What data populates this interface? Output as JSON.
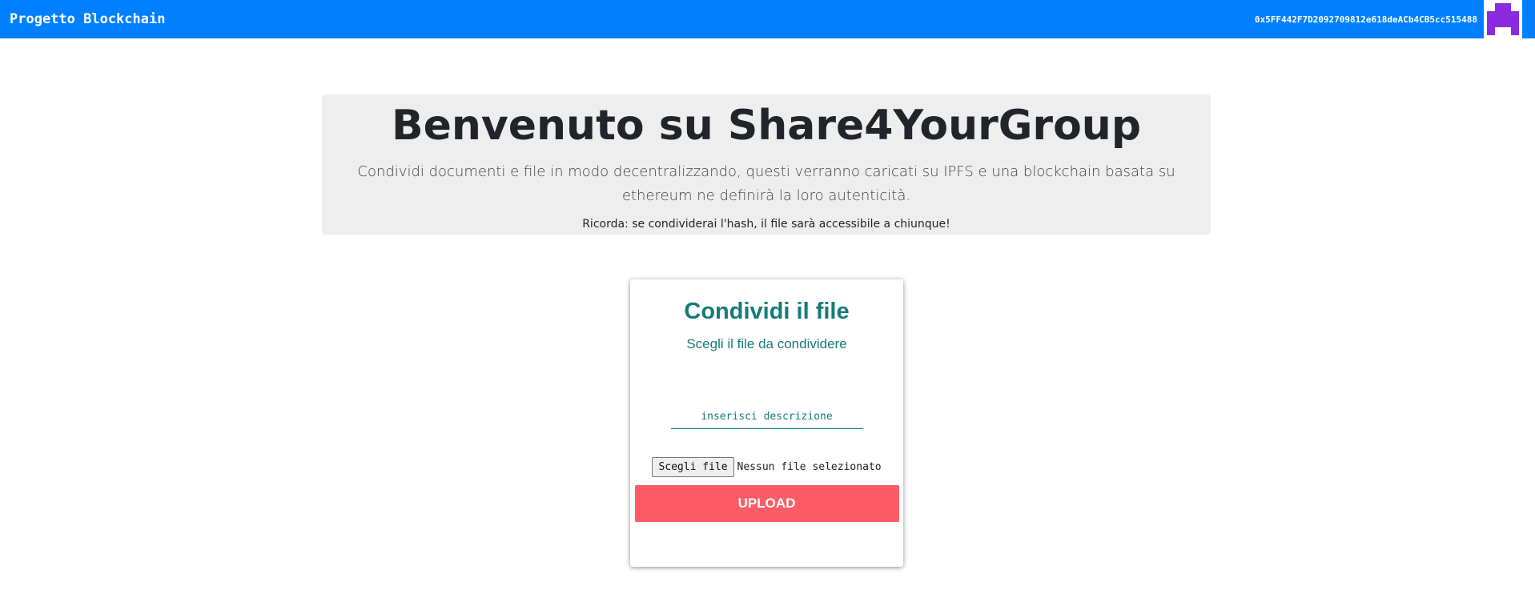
{
  "navbar": {
    "brand": "Progetto Blockchain",
    "account_address": "0x5FF442F7D2092709812e618deACb4CB5cc515488",
    "avatar_colors": {
      "background": "#ffffff",
      "pixel": "#8a2be2"
    }
  },
  "jumbotron": {
    "title": "Benvenuto su Share4YourGroup",
    "lead": "Condividi documenti e file in modo decentralizzando, questi verranno caricati su IPFS e una blockchain basata su ethereum ne definirà la loro autenticità.",
    "note": "Ricorda: se condividerai l'hash, il file sarà accessibile a chiunque!"
  },
  "share_form": {
    "title": "Condividi il file",
    "subtitle": "Scegli il file da condividere",
    "description_placeholder": "inserisci descrizione",
    "file_button_label": "Scegli file",
    "file_status": "Nessun file selezionato",
    "upload_label": "UPLOAD"
  },
  "colors": {
    "navbar": "#0080ff",
    "jumbotron_bg": "#eeeeee",
    "teal_text": "#177a7a",
    "upload_button": "#fc5c65"
  }
}
